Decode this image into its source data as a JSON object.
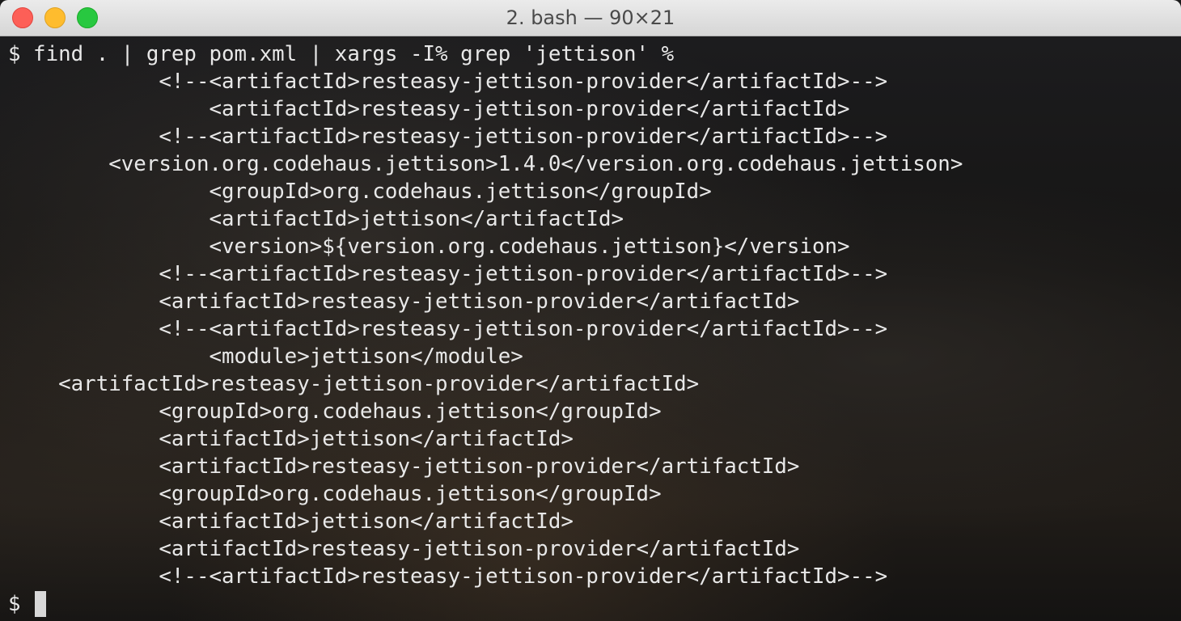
{
  "window": {
    "title": "2. bash — 90×21"
  },
  "terminal": {
    "lines": [
      "$ find . | grep pom.xml | xargs -I% grep 'jettison' %",
      "            <!--<artifactId>resteasy-jettison-provider</artifactId>-->",
      "                <artifactId>resteasy-jettison-provider</artifactId>",
      "            <!--<artifactId>resteasy-jettison-provider</artifactId>-->",
      "        <version.org.codehaus.jettison>1.4.0</version.org.codehaus.jettison>",
      "                <groupId>org.codehaus.jettison</groupId>",
      "                <artifactId>jettison</artifactId>",
      "                <version>${version.org.codehaus.jettison}</version>",
      "            <!--<artifactId>resteasy-jettison-provider</artifactId>-->",
      "            <artifactId>resteasy-jettison-provider</artifactId>",
      "            <!--<artifactId>resteasy-jettison-provider</artifactId>-->",
      "                <module>jettison</module>",
      "    <artifactId>resteasy-jettison-provider</artifactId>",
      "            <groupId>org.codehaus.jettison</groupId>",
      "            <artifactId>jettison</artifactId>",
      "            <artifactId>resteasy-jettison-provider</artifactId>",
      "            <groupId>org.codehaus.jettison</groupId>",
      "            <artifactId>jettison</artifactId>",
      "            <artifactId>resteasy-jettison-provider</artifactId>",
      "            <!--<artifactId>resteasy-jettison-provider</artifactId>-->"
    ],
    "prompt": "$ "
  },
  "colors": {
    "traffic_close": "#fd5f57",
    "traffic_minimize": "#febc2e",
    "traffic_zoom": "#28c840",
    "text": "#e8e8e8"
  }
}
